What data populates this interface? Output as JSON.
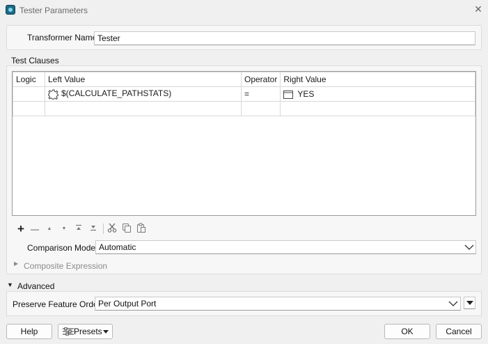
{
  "window": {
    "title": "Tester Parameters",
    "close_glyph": "✕"
  },
  "name_field": {
    "label": "Transformer Name:",
    "value": "Tester"
  },
  "test_clauses": {
    "group_label": "Test Clauses",
    "columns": [
      "Logic",
      "Left Value",
      "Operator",
      "Right Value"
    ],
    "rows": [
      {
        "logic": "",
        "left_value": "$(CALCULATE_PATHSTATS)",
        "left_icon": "parameter-icon",
        "operator": "=",
        "right_value": "YES",
        "right_icon": "text-value-icon"
      },
      {
        "logic": "",
        "left_value": "",
        "operator": "",
        "right_value": ""
      }
    ]
  },
  "toolbar": {
    "icons": [
      "add-icon",
      "remove-icon",
      "move-up-icon",
      "move-down-icon",
      "move-to-top-icon",
      "move-to-bottom-icon",
      "cut-icon",
      "copy-icon",
      "paste-icon"
    ],
    "glyphs": {
      "add": "+",
      "remove": "—",
      "up": "▲",
      "down": "▼",
      "top": "⯭",
      "bottom": "⯯",
      "cut": "✂",
      "copy": "⧉",
      "paste": "📋"
    }
  },
  "comparison_mode": {
    "label": "Comparison Mode:",
    "value": "Automatic"
  },
  "composite": {
    "label": "Composite Expression"
  },
  "advanced": {
    "label": "Advanced",
    "preserve_label": "Preserve Feature Order:",
    "preserve_value": "Per Output Port"
  },
  "footer": {
    "help": "Help",
    "presets": "Presets",
    "ok": "OK",
    "cancel": "Cancel"
  },
  "colors": {
    "accent": "#1c6b86",
    "disabled_text": "#8a8a8a"
  }
}
